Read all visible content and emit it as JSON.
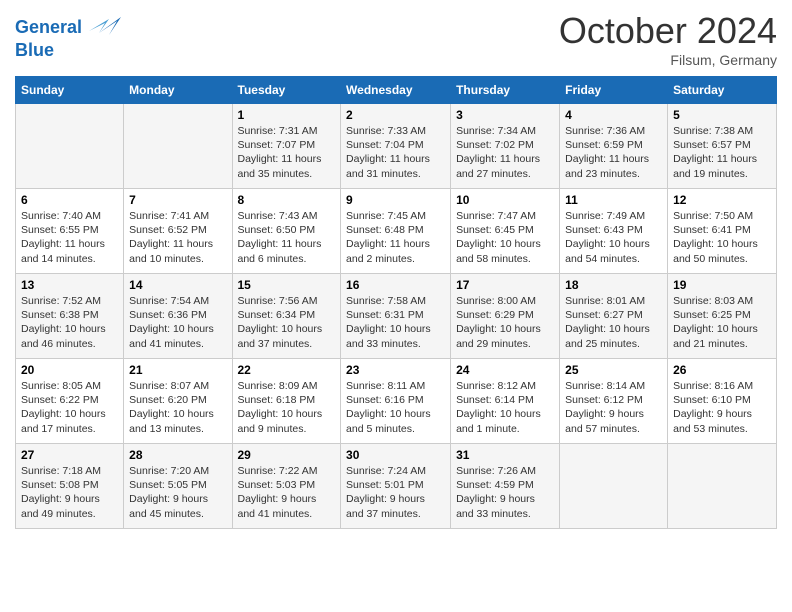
{
  "header": {
    "logo_line1": "General",
    "logo_line2": "Blue",
    "month": "October 2024",
    "location": "Filsum, Germany"
  },
  "days_of_week": [
    "Sunday",
    "Monday",
    "Tuesday",
    "Wednesday",
    "Thursday",
    "Friday",
    "Saturday"
  ],
  "weeks": [
    [
      {
        "day": "",
        "info": ""
      },
      {
        "day": "",
        "info": ""
      },
      {
        "day": "1",
        "info": "Sunrise: 7:31 AM\nSunset: 7:07 PM\nDaylight: 11 hours and 35 minutes."
      },
      {
        "day": "2",
        "info": "Sunrise: 7:33 AM\nSunset: 7:04 PM\nDaylight: 11 hours and 31 minutes."
      },
      {
        "day": "3",
        "info": "Sunrise: 7:34 AM\nSunset: 7:02 PM\nDaylight: 11 hours and 27 minutes."
      },
      {
        "day": "4",
        "info": "Sunrise: 7:36 AM\nSunset: 6:59 PM\nDaylight: 11 hours and 23 minutes."
      },
      {
        "day": "5",
        "info": "Sunrise: 7:38 AM\nSunset: 6:57 PM\nDaylight: 11 hours and 19 minutes."
      }
    ],
    [
      {
        "day": "6",
        "info": "Sunrise: 7:40 AM\nSunset: 6:55 PM\nDaylight: 11 hours and 14 minutes."
      },
      {
        "day": "7",
        "info": "Sunrise: 7:41 AM\nSunset: 6:52 PM\nDaylight: 11 hours and 10 minutes."
      },
      {
        "day": "8",
        "info": "Sunrise: 7:43 AM\nSunset: 6:50 PM\nDaylight: 11 hours and 6 minutes."
      },
      {
        "day": "9",
        "info": "Sunrise: 7:45 AM\nSunset: 6:48 PM\nDaylight: 11 hours and 2 minutes."
      },
      {
        "day": "10",
        "info": "Sunrise: 7:47 AM\nSunset: 6:45 PM\nDaylight: 10 hours and 58 minutes."
      },
      {
        "day": "11",
        "info": "Sunrise: 7:49 AM\nSunset: 6:43 PM\nDaylight: 10 hours and 54 minutes."
      },
      {
        "day": "12",
        "info": "Sunrise: 7:50 AM\nSunset: 6:41 PM\nDaylight: 10 hours and 50 minutes."
      }
    ],
    [
      {
        "day": "13",
        "info": "Sunrise: 7:52 AM\nSunset: 6:38 PM\nDaylight: 10 hours and 46 minutes."
      },
      {
        "day": "14",
        "info": "Sunrise: 7:54 AM\nSunset: 6:36 PM\nDaylight: 10 hours and 41 minutes."
      },
      {
        "day": "15",
        "info": "Sunrise: 7:56 AM\nSunset: 6:34 PM\nDaylight: 10 hours and 37 minutes."
      },
      {
        "day": "16",
        "info": "Sunrise: 7:58 AM\nSunset: 6:31 PM\nDaylight: 10 hours and 33 minutes."
      },
      {
        "day": "17",
        "info": "Sunrise: 8:00 AM\nSunset: 6:29 PM\nDaylight: 10 hours and 29 minutes."
      },
      {
        "day": "18",
        "info": "Sunrise: 8:01 AM\nSunset: 6:27 PM\nDaylight: 10 hours and 25 minutes."
      },
      {
        "day": "19",
        "info": "Sunrise: 8:03 AM\nSunset: 6:25 PM\nDaylight: 10 hours and 21 minutes."
      }
    ],
    [
      {
        "day": "20",
        "info": "Sunrise: 8:05 AM\nSunset: 6:22 PM\nDaylight: 10 hours and 17 minutes."
      },
      {
        "day": "21",
        "info": "Sunrise: 8:07 AM\nSunset: 6:20 PM\nDaylight: 10 hours and 13 minutes."
      },
      {
        "day": "22",
        "info": "Sunrise: 8:09 AM\nSunset: 6:18 PM\nDaylight: 10 hours and 9 minutes."
      },
      {
        "day": "23",
        "info": "Sunrise: 8:11 AM\nSunset: 6:16 PM\nDaylight: 10 hours and 5 minutes."
      },
      {
        "day": "24",
        "info": "Sunrise: 8:12 AM\nSunset: 6:14 PM\nDaylight: 10 hours and 1 minute."
      },
      {
        "day": "25",
        "info": "Sunrise: 8:14 AM\nSunset: 6:12 PM\nDaylight: 9 hours and 57 minutes."
      },
      {
        "day": "26",
        "info": "Sunrise: 8:16 AM\nSunset: 6:10 PM\nDaylight: 9 hours and 53 minutes."
      }
    ],
    [
      {
        "day": "27",
        "info": "Sunrise: 7:18 AM\nSunset: 5:08 PM\nDaylight: 9 hours and 49 minutes."
      },
      {
        "day": "28",
        "info": "Sunrise: 7:20 AM\nSunset: 5:05 PM\nDaylight: 9 hours and 45 minutes."
      },
      {
        "day": "29",
        "info": "Sunrise: 7:22 AM\nSunset: 5:03 PM\nDaylight: 9 hours and 41 minutes."
      },
      {
        "day": "30",
        "info": "Sunrise: 7:24 AM\nSunset: 5:01 PM\nDaylight: 9 hours and 37 minutes."
      },
      {
        "day": "31",
        "info": "Sunrise: 7:26 AM\nSunset: 4:59 PM\nDaylight: 9 hours and 33 minutes."
      },
      {
        "day": "",
        "info": ""
      },
      {
        "day": "",
        "info": ""
      }
    ]
  ]
}
